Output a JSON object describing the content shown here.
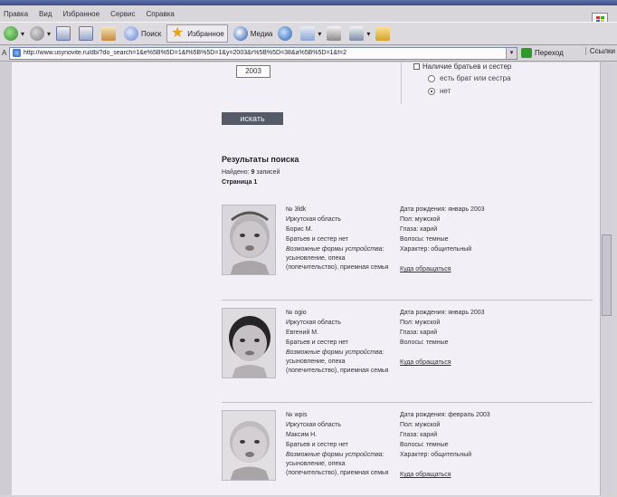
{
  "browser": {
    "menu": [
      "Правка",
      "Вид",
      "Избранное",
      "Сервис",
      "Справка"
    ],
    "toolbar": {
      "search_label": "Поиск",
      "favorites_label": "Избранное",
      "media_label": "Медиа"
    },
    "address": {
      "label": "А",
      "url": "http://www.usynovite.ru/db/?do_search=1&e%5B%5D=1&f%5B%5D=1&y=2003&r%5B%5D=38&a%5B%5D=1&f=2",
      "go_label": "Переход",
      "links_label": "Ссылки"
    }
  },
  "form": {
    "year_value": "2003",
    "siblings_label": "Наличие братьев и сестер",
    "radio_options": [
      {
        "label": "есть брат или сестра",
        "selected": false
      },
      {
        "label": "нет",
        "selected": true
      }
    ],
    "search_button": "искать"
  },
  "results": {
    "title": "Результаты поиска",
    "found_prefix": "Найдено:",
    "found_count": "9",
    "found_suffix": "записей",
    "page_label": "Страница 1",
    "items": [
      {
        "id": "№ 3ldk",
        "region": "Иркутская область",
        "name": "Борис М.",
        "siblings": "Братьев и сестер нет",
        "forms_title": "Возможные формы устройства:",
        "forms_text": "усыновление, опека (попечительство), приемная семья",
        "birth": "Дата рождения: январь 2003",
        "sex": "Пол: мужской",
        "eyes": "Глаза: карий",
        "hair": "Волосы: темные",
        "character": "Характер: общительный",
        "where": "Куда обращаться"
      },
      {
        "id": "№ ogio",
        "region": "Иркутская область",
        "name": "Евгений М.",
        "siblings": "Братьев и сестер нет",
        "forms_title": "Возможные формы устройства:",
        "forms_text": "усыновление, опека (попечительство), приемная семья",
        "birth": "Дата рождения: январь 2003",
        "sex": "Пол: мужской",
        "eyes": "Глаза: карий",
        "hair": "Волосы: темные",
        "character": "",
        "where": "Куда обращаться"
      },
      {
        "id": "№ wpis",
        "region": "Иркутская область",
        "name": "Максим Н.",
        "siblings": "Братьев и сестер нет",
        "forms_title": "Возможные формы устройства:",
        "forms_text": "усыновление, опека (попечительство), приемная семья",
        "birth": "Дата рождения: февраль 2003",
        "sex": "Пол: мужской",
        "eyes": "Глаза: карий",
        "hair": "Волосы: темные",
        "character": "Характер: общительный",
        "where": "Куда обращаться"
      }
    ]
  }
}
